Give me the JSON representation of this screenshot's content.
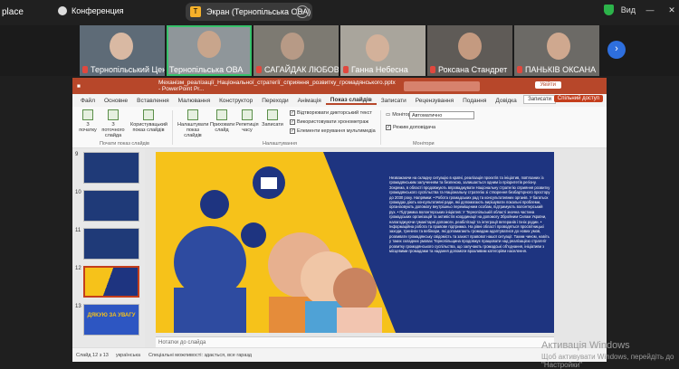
{
  "app": {
    "name": "place",
    "conference_label": "Конференция"
  },
  "screen_share": {
    "label": "Экран (Тернопільська ОВА)",
    "icon": "T",
    "more": "⋯"
  },
  "window": {
    "view_label": "Вид",
    "minimize": "—",
    "close": "✕"
  },
  "participants": [
    {
      "name": "Тернопільський Цен"
    },
    {
      "name": "Тернопільська ОВА"
    },
    {
      "name": "САГАЙДАК ЛЮБОВ"
    },
    {
      "name": "Ганна Небесна"
    },
    {
      "name": "Роксана Стандрет"
    },
    {
      "name": "ПАНЬКІВ ОКСАНА"
    }
  ],
  "ppt": {
    "file_title": "Механізм_реалізації_Національної_стратегії_сприяння_розвитку_громадянського.pptx - PowerPoint Pr...",
    "signin": "Увійти",
    "tabs": [
      "Файл",
      "Основне",
      "Вставлення",
      "Малювання",
      "Конструктор",
      "Переходи",
      "Анімація",
      "Показ слайдів",
      "Записати",
      "Рецензування",
      "Подання",
      "Довідка"
    ],
    "active_tab": "Показ слайдів",
    "record_btn": "Записати",
    "share_btn": "Спільний доступ",
    "ribbon": {
      "b1": "З початку",
      "b2": "З поточного слайда",
      "b3": "Користувацький показ слайдів",
      "b4": "Налаштувати показ слайдів",
      "b5": "Приховати слайд",
      "b6": "Репетиція часу",
      "b7": "Записати",
      "grp1": "Почати показ слайдів",
      "grp2": "Налаштування",
      "grp3": "Монітори",
      "chk1": "Відтворювати дикторський текст",
      "chk2": "Використовувати хронометраж",
      "chk3": "Елементи керування мультимедіа",
      "monitor_label": "Монітор:",
      "monitor_value": "Автоматично",
      "presenter": "Режим доповідача"
    },
    "thumbnails": [
      "9",
      "10",
      "11",
      "12",
      "13"
    ],
    "thumb_caption": "ДЯКУЮ ЗА УВАГУ",
    "slide_text": "Незважаючи на складну ситуацію в країні, реалізація проєктів та ініціатив, пов'язаних із громадянським залученням та безпекою, залишається одним із пріоритетів регіону. Зокрема, в області продовжують впроваджувати Національну стратегію сприяння розвитку громадянського суспільства та Національну стратегію зі створення безбар'єрного простору до 2030 року. Напрямки: • Робота громадських рад та консультативних органів. У багатьох громадах діють консультативні ради, які допомагають вирішувати локальні проблеми, організовують допомогу внутрішньо переміщеним особам, підтримують волонтерський рух. • Підтримка волонтерських ініціатив: У Тернопільській області значна частина громадських організацій та активістів координації на допомогу Збройним Силам України, налагоджуючи гуманітарні допомоги, реабілітації та інтеграції ветеранів і їхніх родин. • Інформаційна робота та правове підтримка. На рівні області проводяться просвітницькі заходи, тренінги та вебінари, які допомагають громадам адаптуватися до нових умов, розвивати громадянську свідомість та захист правової нашої ситуації. Таким чином, навіть у таких складних умовах Тернопільщина продовжує працювати над реалізацією стратегії розвитку громадянського суспільства, що залучають громадські об'єднання, ініціативи з місцевими громадами та надання допомоги вразливим категоріям населення.",
    "notes_placeholder": "Нотатки до слайда",
    "status_slide": "Слайд 12 з 13",
    "status_lang": "українська",
    "status_access": "Спеціальні можливості: здається, все гаразд"
  },
  "activation": {
    "line1": "Активація Windows",
    "line2": "Щоб активувати Windows, перейдіть до \"Настройки\""
  },
  "colors": {
    "accent": "#b7472a",
    "slide_bg": "#1e3480",
    "yellow": "#f6c21a"
  }
}
